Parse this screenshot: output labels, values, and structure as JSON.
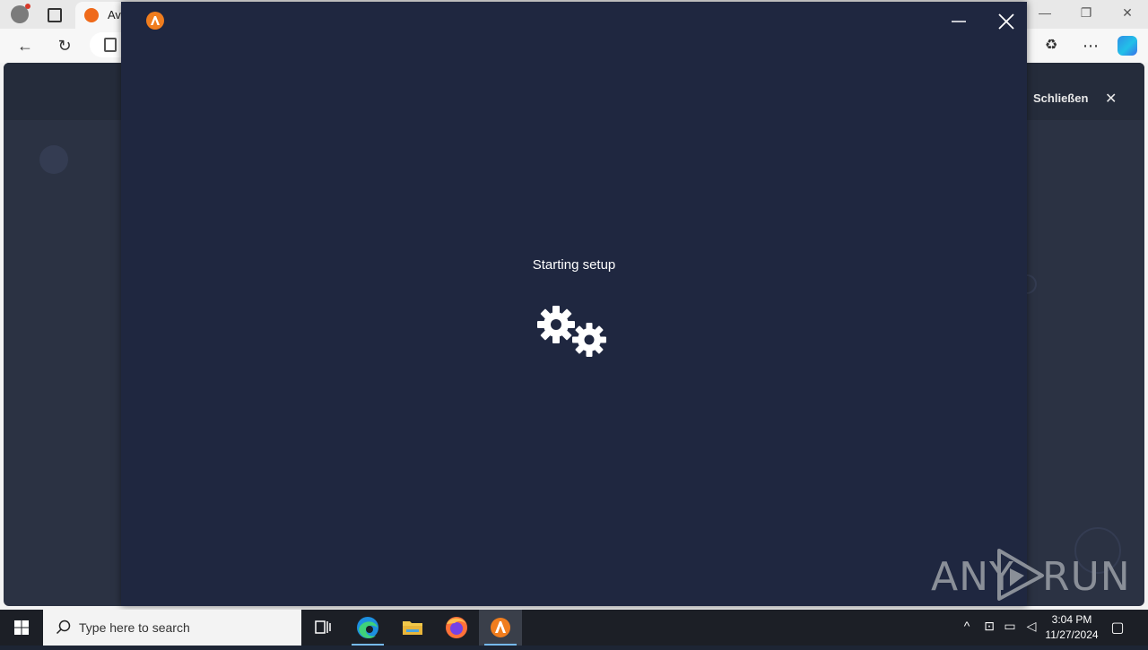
{
  "browser": {
    "tab_title": "Ava",
    "close_link": "Schließen"
  },
  "installer": {
    "status": "Starting setup"
  },
  "watermark": {
    "left": "ANY",
    "right": "RUN"
  },
  "taskbar": {
    "search_placeholder": "Type here to search",
    "time": "3:04 PM",
    "date": "11/27/2024"
  },
  "colors": {
    "installer_bg": "#1f2740",
    "avast_orange": "#f07d1e",
    "taskbar_bg": "#1c1f26"
  }
}
